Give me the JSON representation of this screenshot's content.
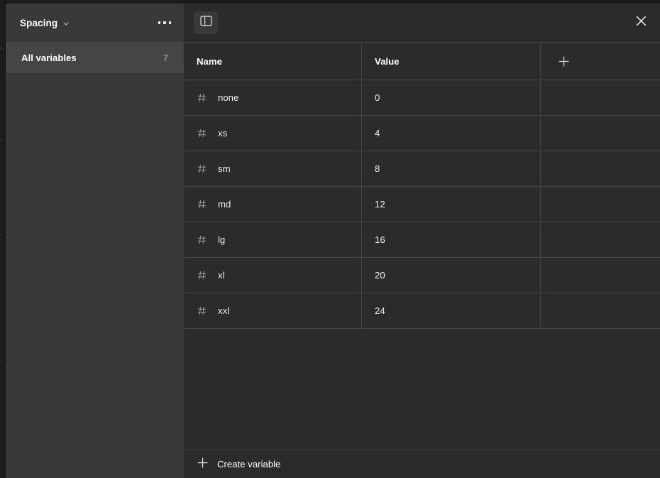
{
  "window": {
    "background": "#2b2b2b",
    "sidebar_background": "#383838",
    "accent": "#0d99ff"
  },
  "sidebar": {
    "collection_name": "Spacing",
    "collection_chevron_icon": "chevron-down-icon",
    "overflow_menu_icon": "kebab-menu-icon",
    "items": [
      {
        "label": "All variables",
        "count": "7",
        "selected": true
      }
    ]
  },
  "toolbar": {
    "panel_toggle_icon": "sidebar-panel-toggle-icon",
    "close_icon": "close-icon"
  },
  "table": {
    "columns": [
      {
        "key": "name",
        "label": "Name"
      },
      {
        "key": "value",
        "label": "Value"
      },
      {
        "key": "add",
        "label": "+",
        "icon": "plus-icon"
      }
    ],
    "rows": [
      {
        "type_icon": "hash-number-icon",
        "name": "none",
        "value": "0"
      },
      {
        "type_icon": "hash-number-icon",
        "name": "xs",
        "value": "4"
      },
      {
        "type_icon": "hash-number-icon",
        "name": "sm",
        "value": "8"
      },
      {
        "type_icon": "hash-number-icon",
        "name": "md",
        "value": "12"
      },
      {
        "type_icon": "hash-number-icon",
        "name": "lg",
        "value": "16"
      },
      {
        "type_icon": "hash-number-icon",
        "name": "xl",
        "value": "20"
      },
      {
        "type_icon": "hash-number-icon",
        "name": "xxl",
        "value": "24"
      }
    ]
  },
  "footer": {
    "create_label": "Create variable",
    "create_icon": "plus-icon"
  }
}
